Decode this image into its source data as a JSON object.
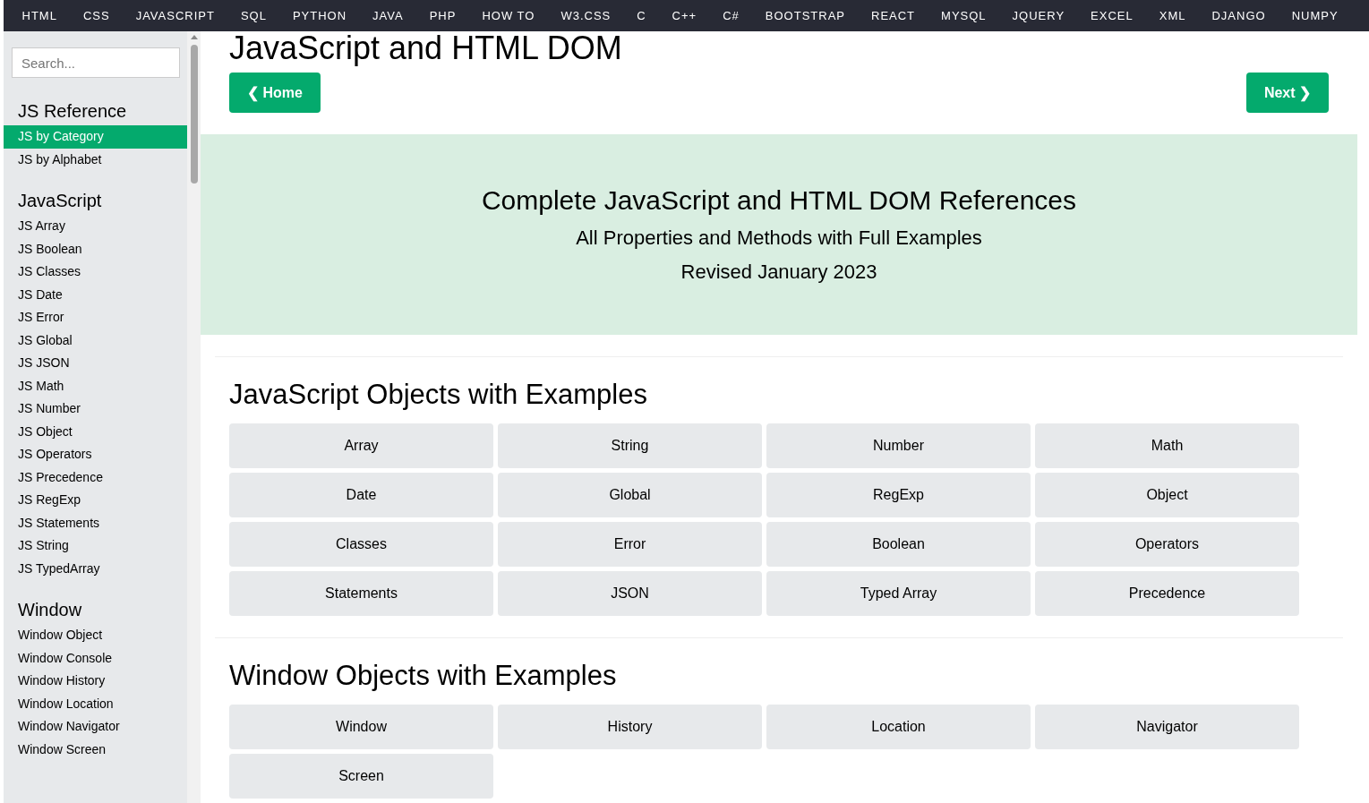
{
  "nav": [
    "HTML",
    "CSS",
    "JAVASCRIPT",
    "SQL",
    "PYTHON",
    "JAVA",
    "PHP",
    "HOW TO",
    "W3.CSS",
    "C",
    "C++",
    "C#",
    "BOOTSTRAP",
    "REACT",
    "MYSQL",
    "JQUERY",
    "EXCEL",
    "XML",
    "DJANGO",
    "NUMPY"
  ],
  "sidebar": {
    "search": {
      "placeholder": "Search..."
    },
    "sections": [
      {
        "title": "JS Reference",
        "items": [
          {
            "label": "JS by Category",
            "selected": true
          },
          {
            "label": "JS by Alphabet",
            "selected": false
          }
        ]
      },
      {
        "title": "JavaScript",
        "items": [
          {
            "label": "JS Array",
            "selected": false
          },
          {
            "label": "JS Boolean",
            "selected": false
          },
          {
            "label": "JS Classes",
            "selected": false
          },
          {
            "label": "JS Date",
            "selected": false
          },
          {
            "label": "JS Error",
            "selected": false
          },
          {
            "label": "JS Global",
            "selected": false
          },
          {
            "label": "JS JSON",
            "selected": false
          },
          {
            "label": "JS Math",
            "selected": false
          },
          {
            "label": "JS Number",
            "selected": false
          },
          {
            "label": "JS Object",
            "selected": false
          },
          {
            "label": "JS Operators",
            "selected": false
          },
          {
            "label": "JS Precedence",
            "selected": false
          },
          {
            "label": "JS RegExp",
            "selected": false
          },
          {
            "label": "JS Statements",
            "selected": false
          },
          {
            "label": "JS String",
            "selected": false
          },
          {
            "label": "JS TypedArray",
            "selected": false
          }
        ]
      },
      {
        "title": "Window",
        "items": [
          {
            "label": "Window Object",
            "selected": false
          },
          {
            "label": "Window Console",
            "selected": false
          },
          {
            "label": "Window History",
            "selected": false
          },
          {
            "label": "Window Location",
            "selected": false
          },
          {
            "label": "Window Navigator",
            "selected": false
          },
          {
            "label": "Window Screen",
            "selected": false
          }
        ]
      }
    ]
  },
  "page_title": "JavaScript and HTML DOM",
  "buttons": {
    "prev": "❮ Home",
    "next": "Next ❯"
  },
  "banner": {
    "title": "Complete JavaScript and HTML DOM References",
    "subtitle": "All Properties and Methods with Full Examples",
    "revised": "Revised January 2023"
  },
  "sections": [
    {
      "title": "JavaScript Objects with Examples",
      "links": [
        "Array",
        "String",
        "Number",
        "Math",
        "Date",
        "Global",
        "RegExp",
        "Object",
        "Classes",
        "Error",
        "Boolean",
        "Operators",
        "Statements",
        "JSON",
        "Typed Array",
        "Precedence"
      ]
    },
    {
      "title": "Window Objects with Examples",
      "links": [
        "Window",
        "History",
        "Location",
        "Navigator",
        "Screen"
      ]
    }
  ]
}
